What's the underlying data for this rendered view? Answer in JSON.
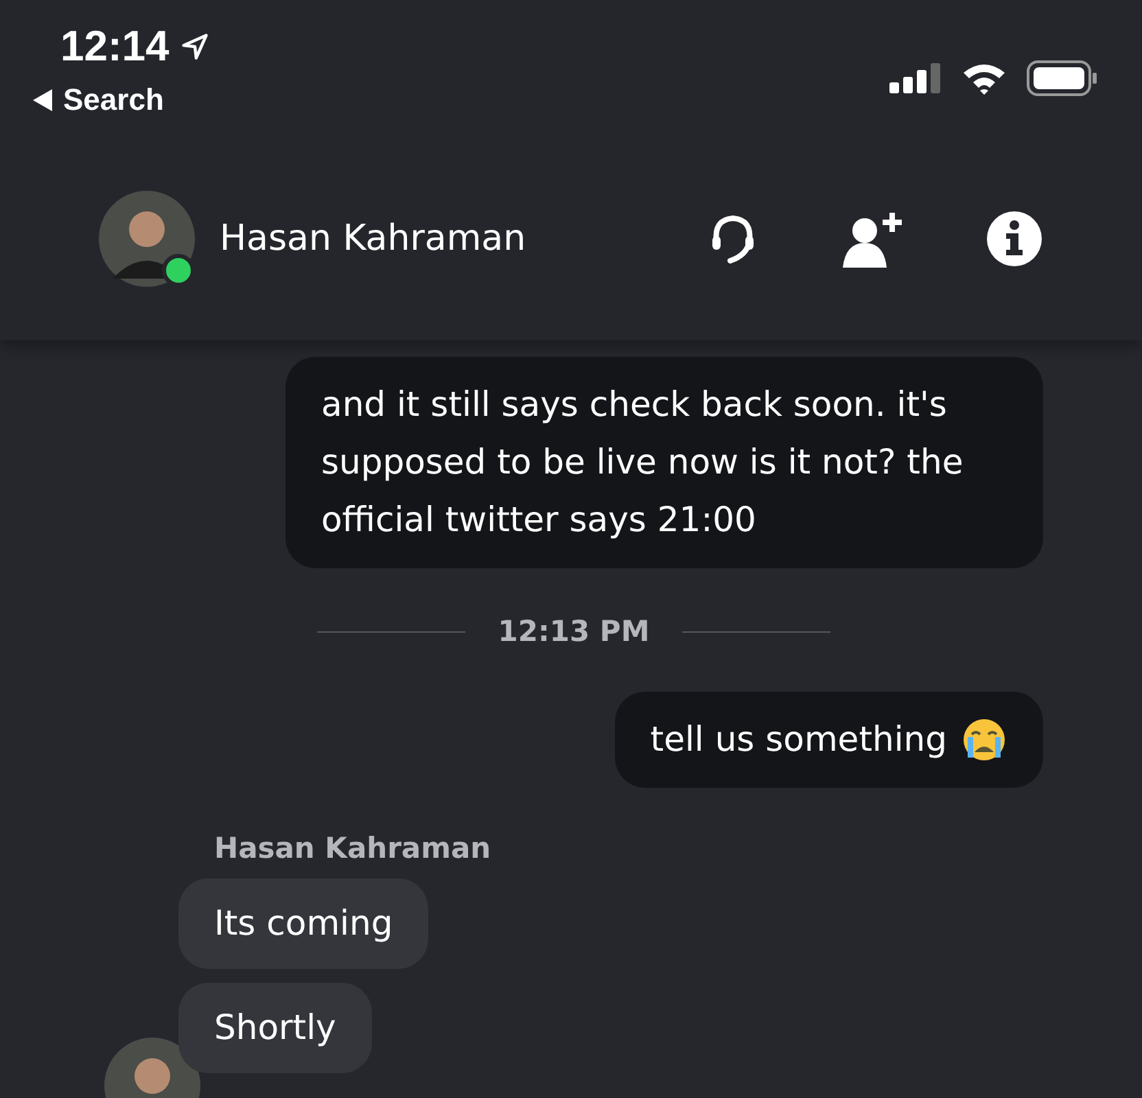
{
  "status_bar": {
    "time": "12:14",
    "back": "Search"
  },
  "header": {
    "contact": {
      "name": "Hasan Kahraman",
      "online": true
    }
  },
  "messages": [
    {
      "kind": "outgoing",
      "text": "and it still says check back soon. it's supposed to be live now is it not? the official twitter says 21:00"
    },
    {
      "kind": "divider",
      "text": "12:13 PM"
    },
    {
      "kind": "outgoing",
      "text": "tell us something",
      "emoji": true
    },
    {
      "kind": "sender",
      "text": "Hasan Kahraman"
    },
    {
      "kind": "incoming",
      "text": "Its coming"
    },
    {
      "kind": "incoming",
      "text": "Shortly",
      "avatar": true
    }
  ]
}
